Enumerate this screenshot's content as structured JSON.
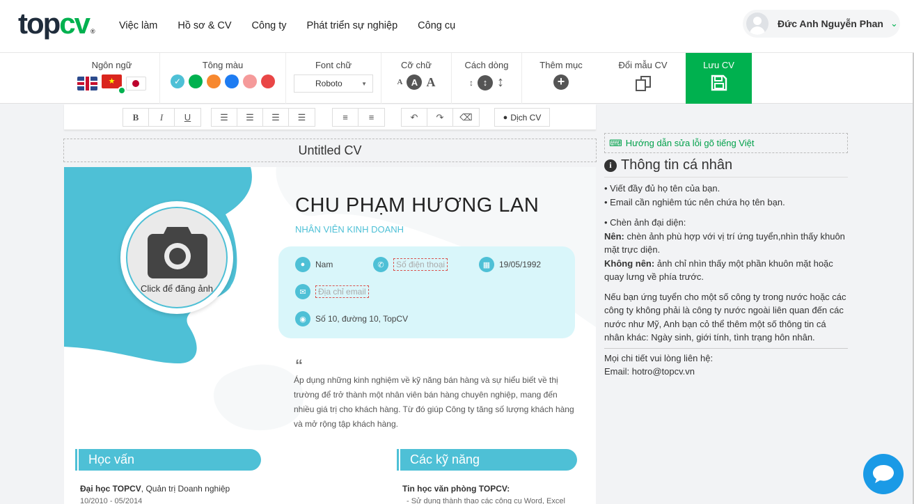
{
  "header": {
    "logo_main": "top",
    "logo_accent": "cv",
    "logo_mark": "®",
    "nav": [
      "Việc làm",
      "Hồ sơ & CV",
      "Công ty",
      "Phát triển sự nghiệp",
      "Công cụ"
    ],
    "user_name": "Đức Anh Nguyễn Phan"
  },
  "toolbar": {
    "language_label": "Ngôn ngữ",
    "color_label": "Tông màu",
    "colors": [
      "#4ec0d6",
      "#00b14f",
      "#f7882f",
      "#1e7cf2",
      "#f59a9a",
      "#e94646"
    ],
    "font_label": "Font chữ",
    "font_value": "Roboto",
    "size_label": "Cỡ chữ",
    "spacing_label": "Cách dòng",
    "add_section_label": "Thêm mục",
    "change_template_label": "Đổi mẫu CV",
    "save_label": "Lưu CV"
  },
  "format": {
    "bold": "B",
    "italic": "I",
    "underline": "U",
    "translate_label": "Dịch CV"
  },
  "cv": {
    "file_title": "Untitled CV",
    "photo_label": "Click để đăng ảnh",
    "name": "CHU PHẠM HƯƠNG LAN",
    "position": "NHÂN VIÊN KINH DOANH",
    "gender": "Nam",
    "phone_placeholder": "Số điện thoại",
    "birthday": "19/05/1992",
    "email_placeholder": "Địa chỉ email",
    "address": "Số 10, đường 10, TopCV",
    "objective": "Áp dụng những kinh nghiệm về kỹ năng bán hàng và sự hiểu biết về thị trường để trở thành một nhân viên bán hàng chuyên nghiệp, mang đến nhiều giá trị cho khách hàng. Từ đó giúp Công ty tăng số lượng khách hàng và mở rộng tập khách hàng.",
    "education_title": "Học vấn",
    "school": "Đại học TOPCV",
    "major": "Quản trị Doanh nghiệp",
    "edu_period": "10/2010 - 05/2014",
    "skills_title": "Các kỹ năng",
    "skill_name": "Tin học văn phòng TOPCV",
    "skill_desc": "- Sử dụng thành thạo các công cụ Word, Excel"
  },
  "sidebar": {
    "guide_link": "Hướng dẫn sửa lỗi gõ tiếng Việt",
    "title": "Thông tin cá nhân",
    "tip1": "• Viết đầy đủ họ tên của bạn.",
    "tip2": "• Email cần nghiêm túc nên chứa họ tên bạn.",
    "tip3": "• Chèn ảnh đại diện:",
    "should_label": "Nên:",
    "should_text": "chèn ảnh phù hợp với vị trí ứng tuyển,nhìn thấy khuôn mặt trực diện.",
    "shouldnt_label": "Không nên:",
    "shouldnt_text": "ảnh chỉ nhìn thấy một phần khuôn mặt hoặc quay lưng về phía trước.",
    "note": "Nếu bạn ứng tuyển cho một số công ty trong nước hoặc các công ty không phải là công ty nước ngoài liên quan đến các nước như Mỹ, Anh bạn cỏ thể thêm một số thông tin cá nhân khác: Ngày sinh, giới tính, tình trạng hôn nhân.",
    "contact_line": "Mọi chi tiết vui lòng liên hệ:",
    "contact_email": "Email: hotro@topcv.vn"
  }
}
